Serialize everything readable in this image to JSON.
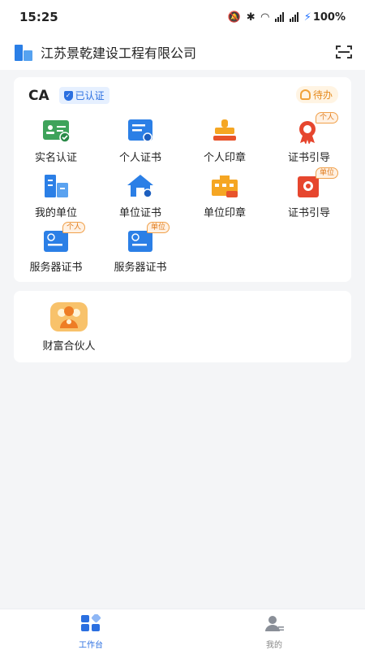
{
  "status_bar": {
    "time": "15:25",
    "network": "5G",
    "battery": "100%"
  },
  "header": {
    "company_name": "江苏景乾建设工程有限公司"
  },
  "ca_section": {
    "title": "CA",
    "verified_label": "已认证",
    "todo_label": "待办",
    "items": [
      {
        "label": "实名认证"
      },
      {
        "label": "个人证书"
      },
      {
        "label": "个人印章"
      },
      {
        "label": "证书引导",
        "badge": "个人"
      },
      {
        "label": "我的单位"
      },
      {
        "label": "单位证书"
      },
      {
        "label": "单位印章"
      },
      {
        "label": "证书引导",
        "badge": "单位"
      },
      {
        "label": "服务器证书",
        "badge": "个人"
      },
      {
        "label": "服务器证书",
        "badge": "单位"
      }
    ]
  },
  "partner_section": {
    "label": "财富合伙人"
  },
  "tabbar": {
    "tabs": [
      {
        "label": "工作台"
      },
      {
        "label": "我的"
      }
    ]
  },
  "colors": {
    "brand_blue": "#2b6fe0",
    "accent_orange": "#f0a23a",
    "background": "#f4f5f7"
  }
}
